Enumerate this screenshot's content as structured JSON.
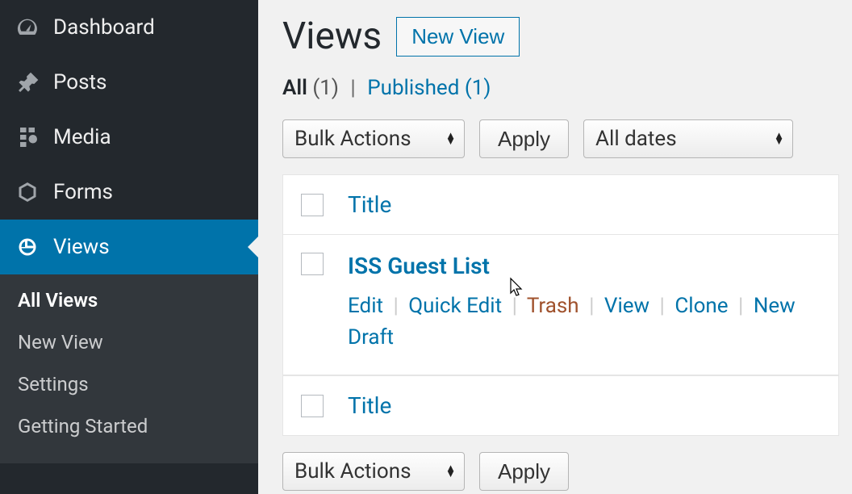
{
  "sidebar": {
    "items": [
      {
        "label": "Dashboard"
      },
      {
        "label": "Posts"
      },
      {
        "label": "Media"
      },
      {
        "label": "Forms"
      },
      {
        "label": "Views"
      }
    ],
    "subitems": [
      {
        "label": "All Views"
      },
      {
        "label": "New View"
      },
      {
        "label": "Settings"
      },
      {
        "label": "Getting Started"
      }
    ]
  },
  "header": {
    "title": "Views",
    "new_btn": "New View"
  },
  "filters": {
    "all_label": "All",
    "all_count": "(1)",
    "separator": "|",
    "published_label": "Published",
    "published_count": "(1)"
  },
  "controls": {
    "bulk_actions": "Bulk Actions",
    "apply": "Apply",
    "all_dates": "All dates"
  },
  "table": {
    "title_header": "Title",
    "rows": [
      {
        "title": "ISS Guest List",
        "actions": {
          "edit": "Edit",
          "quick_edit": "Quick Edit",
          "trash": "Trash",
          "view": "View",
          "clone": "Clone",
          "new_draft": "New Draft"
        }
      }
    ]
  }
}
